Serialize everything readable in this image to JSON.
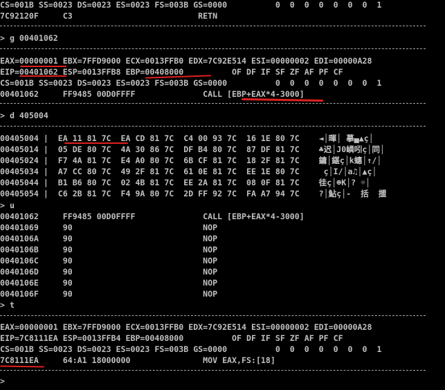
{
  "colors": {
    "background": "#000000",
    "text": "#c0c0c0",
    "separator": "#a8a8a8",
    "annotation": "#e02020"
  },
  "lines": [
    "CS=001B SS=0023 DS=0023 ES=0023 FS=003B GS=0000          0  0  0  0  0  0  0  1",
    "7C92120F     C3                          RETN",
    "> g 00401062",
    "EAX=00000001 EBX=7FFD9000 ECX=0013FFB0 EDX=7C92E514 ESI=00000002 EDI=00000A28",
    "EIP=00401062 ESP=0013FFB8 EBP=00408000          OF DF IF SF ZF AF PF CF",
    "CS=001B SS=0023 DS=0023 ES=0023 FS=003B GS=0000          0  0  0  0  0  0  0  1",
    "00401062     FF9485 00D0FFFF              CALL [EBP+EAX*4-3000]",
    "> d 405004",
    "00405004 |  EA 11 81 7C  EA CD 81 7C  C4 00 93 7C  16 1E 80 7C    ◄│暉│ 摹▄▲ç│",
    "00405014 |  05 DE 80 7C  4A 30 86 7C  DF B4 80 7C  87 DF 81 7C    ♣迟│J0嶙吲ç│同│",
    "00405024 |  F7 4A 81 7C  E4 A0 80 7C  6B CF 81 7C  18 2F 81 7C    鏞│鍖ç│k蟪│↑/│",
    "00405034 |  A7 CC 80 7C  49 2F 81 7C  61 0E 81 7C  EE 1E 80 7C     ç│I/│a♫│▲ç│",
    "00405044 |  B1 B6 80 7C  02 4B 81 7C  EE 2A 81 7C  08 0F 81 7C    徍ç│☻K│? ☼│",
    "00405054 |  C6 2B 81 7C  F4 9A 80 7C  2D FF 92 7C  FA A7 94 7C    ?│鮎ç│-  括  擝",
    "> u",
    "00401062     FF9485 00D0FFFF              CALL [EBP+EAX*4-3000]",
    "00401069     90                           NOP",
    "0040106A     90                           NOP",
    "0040106B     90                           NOP",
    "0040106C     90                           NOP",
    "0040106D     90                           NOP",
    "0040106E     90                           NOP",
    "0040106F     90                           NOP",
    "> t",
    "EAX=00000001 EBX=7FFD9000 ECX=0013FFB0 EDX=7C92E514 ESI=00000002 EDI=00000A28",
    "EIP=7C8111EA ESP=0013FFB4 EBP=00408000          OF DF IF SF ZF AF PF CF",
    "CS=001B SS=0023 DS=0023 ES=0023 FS=003B GS=0000          0  0  0  0  0  0  0  1",
    "7C8111EA     64:A1 18000000               MOV EAX,FS:[18]",
    ">"
  ]
}
